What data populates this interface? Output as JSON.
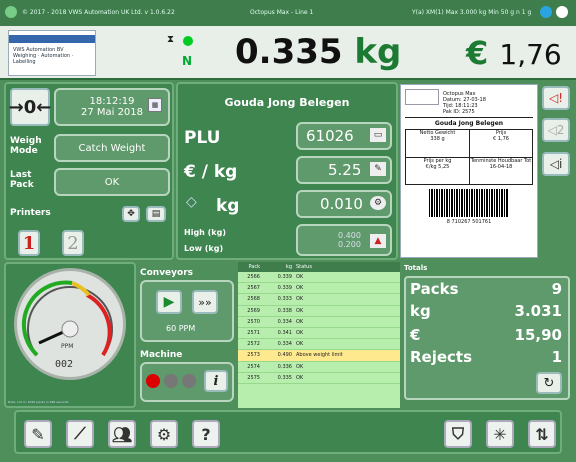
{
  "topbar": {
    "left": "© 2017 - 2018 VWS Automation UK Ltd. v 1.0.6.22",
    "middle": "Octopus Max - Line 1",
    "right": "Y(a) XM(1) Max 3.000 kg Min 50 g n 1 g"
  },
  "header": {
    "logo_text": "VWS Automation BV\nWeighing · Automation · Labelling",
    "n_label": "N",
    "weight_value": "0.335",
    "weight_unit": "kg",
    "currency": "€",
    "price_value": "1,76"
  },
  "left": {
    "datetime_time": "18:12:19",
    "datetime_date": "27 Mai 2018",
    "weigh_mode_label": "Weigh Mode",
    "weigh_mode_value": "Catch Weight",
    "last_pack_label": "Last Pack",
    "last_pack_value": "OK",
    "printers_label": "Printers",
    "printer1": "1",
    "printer2": "2"
  },
  "product": {
    "name": "Gouda Jong Belegen",
    "plu_label": "PLU",
    "plu_value": "61026",
    "price_kg_label": "€ / kg",
    "price_kg_value": "5.25",
    "kg_label": "kg",
    "kg_value": "0.010",
    "high_label": "High (kg)",
    "low_label": "Low (kg)",
    "high_value": "0.400",
    "low_value": "0.200"
  },
  "label": {
    "header1": "Octopus Max",
    "header2": "Datum: 27-03-18",
    "header3": "Tijd: 18:11:23",
    "header4": "Pak ID: 2575",
    "product": "Gouda Jong Belegen",
    "netto_label": "Netto Gewicht",
    "netto_value": "338 g",
    "prijs_label": "Prijs",
    "prijs_value": "€ 1,76",
    "ppk_label": "Prijs per kg",
    "ppk_value": "€/kg 5,25",
    "tht_label": "Tenminste Houdbaar Tot",
    "tht_value": "16-04-18",
    "barcode": "8 710267 501761"
  },
  "conveyors": {
    "title": "Conveyors",
    "ppm": "60 PPM"
  },
  "machine": {
    "title": "Machine"
  },
  "gauge": {
    "unit": "PPM",
    "value": "002",
    "bottom_note": "Note: not in: 1095 packs in 186 seconds"
  },
  "table": {
    "headers": [
      "Pack",
      "kg",
      "Status"
    ],
    "rows": [
      [
        "2566",
        "0.339",
        "OK"
      ],
      [
        "2567",
        "0.339",
        "OK"
      ],
      [
        "2568",
        "0.333",
        "OK"
      ],
      [
        "2569",
        "0.338",
        "OK"
      ],
      [
        "2570",
        "0.334",
        "OK"
      ],
      [
        "2571",
        "0.341",
        "OK"
      ],
      [
        "2572",
        "0.334",
        "OK"
      ],
      [
        "2573",
        "0.490",
        "Above weight limit"
      ],
      [
        "2574",
        "0.336",
        "OK"
      ],
      [
        "2575",
        "0.335",
        "OK"
      ]
    ]
  },
  "totals": {
    "title": "Totals",
    "packs_label": "Packs",
    "packs_value": "9",
    "kg_label": "kg",
    "kg_value": "3.031",
    "euro_label": "€",
    "euro_value": "15,90",
    "rejects_label": "Rejects",
    "rejects_value": "1"
  },
  "colors": {
    "accent": "#1d7a33",
    "panel": "#3f8550"
  }
}
